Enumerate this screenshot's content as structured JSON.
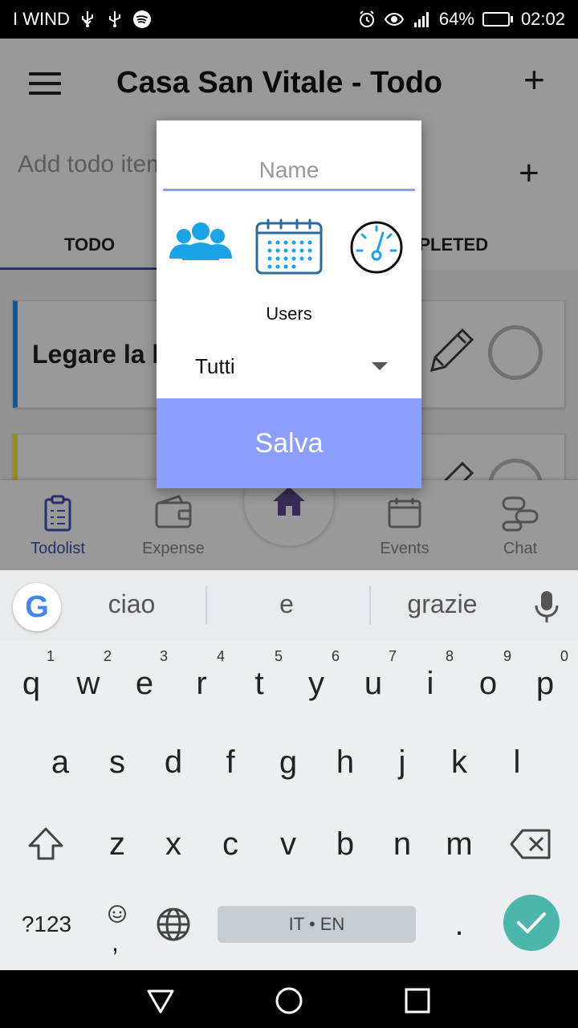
{
  "status_bar": {
    "carrier": "I WIND",
    "battery": "64%",
    "battery_level": 0.64,
    "time": "02:02"
  },
  "app_bar": {
    "title": "Casa San Vitale - Todo",
    "add_icon": "plus-icon",
    "menu_icon": "hamburger-icon"
  },
  "add_todo": {
    "placeholder": "Add todo item",
    "add_icon": "plus-icon"
  },
  "tabs": {
    "active": "TODO",
    "completed": "COMPLETED"
  },
  "list": {
    "items": [
      {
        "title": "Legare la b",
        "color": "#2196f3"
      },
      {
        "title": "",
        "color": "#ffeb3b"
      }
    ]
  },
  "bottom_nav": {
    "items": [
      {
        "label": "Todolist",
        "icon": "clipboard-icon"
      },
      {
        "label": "Expense",
        "icon": "wallet-icon"
      },
      {
        "label": "",
        "icon": "home-icon"
      },
      {
        "label": "Events",
        "icon": "calendar-icon"
      },
      {
        "label": "Chat",
        "icon": "chat-icon"
      }
    ]
  },
  "dialog": {
    "name_placeholder": "Name",
    "section_label": "Users",
    "selected_user": "Tutti",
    "save_label": "Salva",
    "accent": "#8c9eff",
    "icons": [
      "users-icon",
      "calendar-icon",
      "gauge-icon"
    ]
  },
  "keyboard": {
    "suggestions": [
      "ciao",
      "e",
      "grazie"
    ],
    "row1": [
      "q",
      "w",
      "e",
      "r",
      "t",
      "y",
      "u",
      "i",
      "o",
      "p"
    ],
    "row1_nums": [
      "1",
      "2",
      "3",
      "4",
      "5",
      "6",
      "7",
      "8",
      "9",
      "0"
    ],
    "row2": [
      "a",
      "s",
      "d",
      "f",
      "g",
      "h",
      "j",
      "k",
      "l"
    ],
    "row3": [
      "z",
      "x",
      "c",
      "v",
      "b",
      "n",
      "m"
    ],
    "symbols_label": "?123",
    "comma_label": ",",
    "space_label": "IT • EN",
    "period_label": ".",
    "enter_color": "#4db6ac"
  }
}
